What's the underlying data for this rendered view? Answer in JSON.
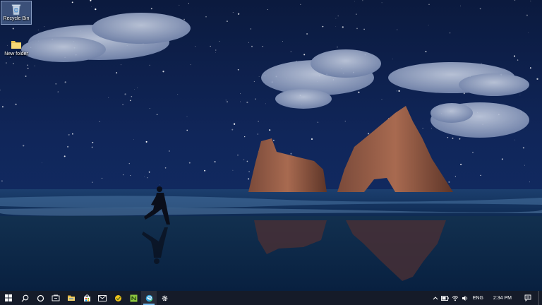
{
  "desktop": {
    "icons": [
      {
        "label": "Recycle Bin",
        "icon": "recycle-bin-icon"
      },
      {
        "label": "New folder",
        "icon": "folder-icon"
      }
    ]
  },
  "taskbar": {
    "pinned": [
      {
        "icon": "windows-start-icon"
      },
      {
        "icon": "search-icon"
      },
      {
        "icon": "cortana-icon"
      },
      {
        "icon": "task-view-icon"
      },
      {
        "icon": "file-explorer-icon"
      },
      {
        "icon": "store-icon"
      },
      {
        "icon": "mail-icon"
      },
      {
        "icon": "app-icon"
      },
      {
        "icon": "notepad-plus-plus-icon"
      },
      {
        "icon": "edge-icon"
      },
      {
        "icon": "settings-icon"
      }
    ],
    "tray": {
      "language": "ENG",
      "time": "2:34 PM"
    }
  },
  "colors": {
    "accent": "#76b9ed",
    "taskbar": "#161a24"
  }
}
